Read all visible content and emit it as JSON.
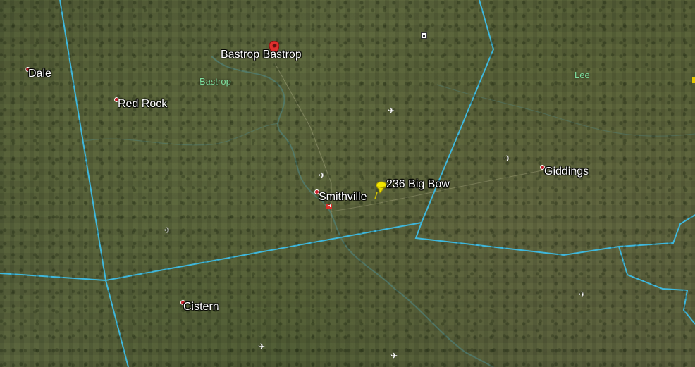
{
  "map": {
    "places": [
      {
        "name": "Bastrop Bastrop"
      },
      {
        "name": "Dale"
      },
      {
        "name": "Red Rock"
      },
      {
        "name": "Smithville"
      },
      {
        "name": "Giddings"
      },
      {
        "name": "Cistern"
      }
    ],
    "counties": [
      {
        "name": "Bastrop"
      },
      {
        "name": "Lee"
      }
    ],
    "placemark": {
      "label": "236 Big Bow",
      "color": "#f2e600"
    },
    "colors": {
      "boundary": "#3fb7dc",
      "river": "#4f8a8a",
      "county_label": "#7fe0a0",
      "town_dot": "#c81e2a"
    },
    "icons": [
      "airport-icon",
      "hospital-icon",
      "pin-icon",
      "pushpin-icon"
    ]
  }
}
